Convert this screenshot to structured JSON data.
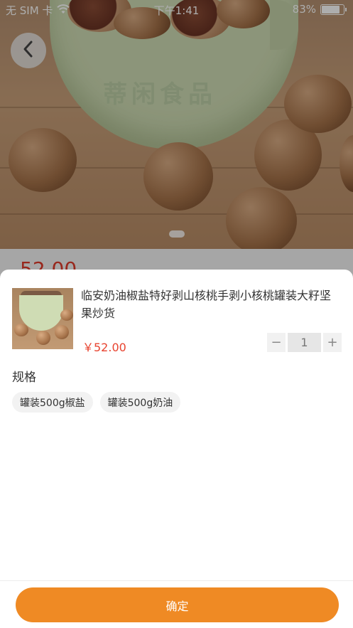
{
  "status_bar": {
    "carrier": "无 SIM 卡",
    "time": "下午1:41",
    "battery_percent": "83%",
    "battery_level": 0.83
  },
  "hero": {
    "watermark": "蒂闲食品",
    "image": "walnuts-in-green-bowl"
  },
  "background_page": {
    "price": "52.00"
  },
  "sheet": {
    "product_title": "临安奶油椒盐特好剥山核桃手剥小核桃罐装大籽坚果炒货",
    "price": "￥52.00",
    "quantity": "1",
    "minus_label": "−",
    "plus_label": "+",
    "spec_label": "规格",
    "options": [
      "罐装500g椒盐",
      "罐装500g奶油"
    ],
    "confirm_label": "确定"
  },
  "colors": {
    "accent": "#ef8a24",
    "price": "#e8432f"
  }
}
